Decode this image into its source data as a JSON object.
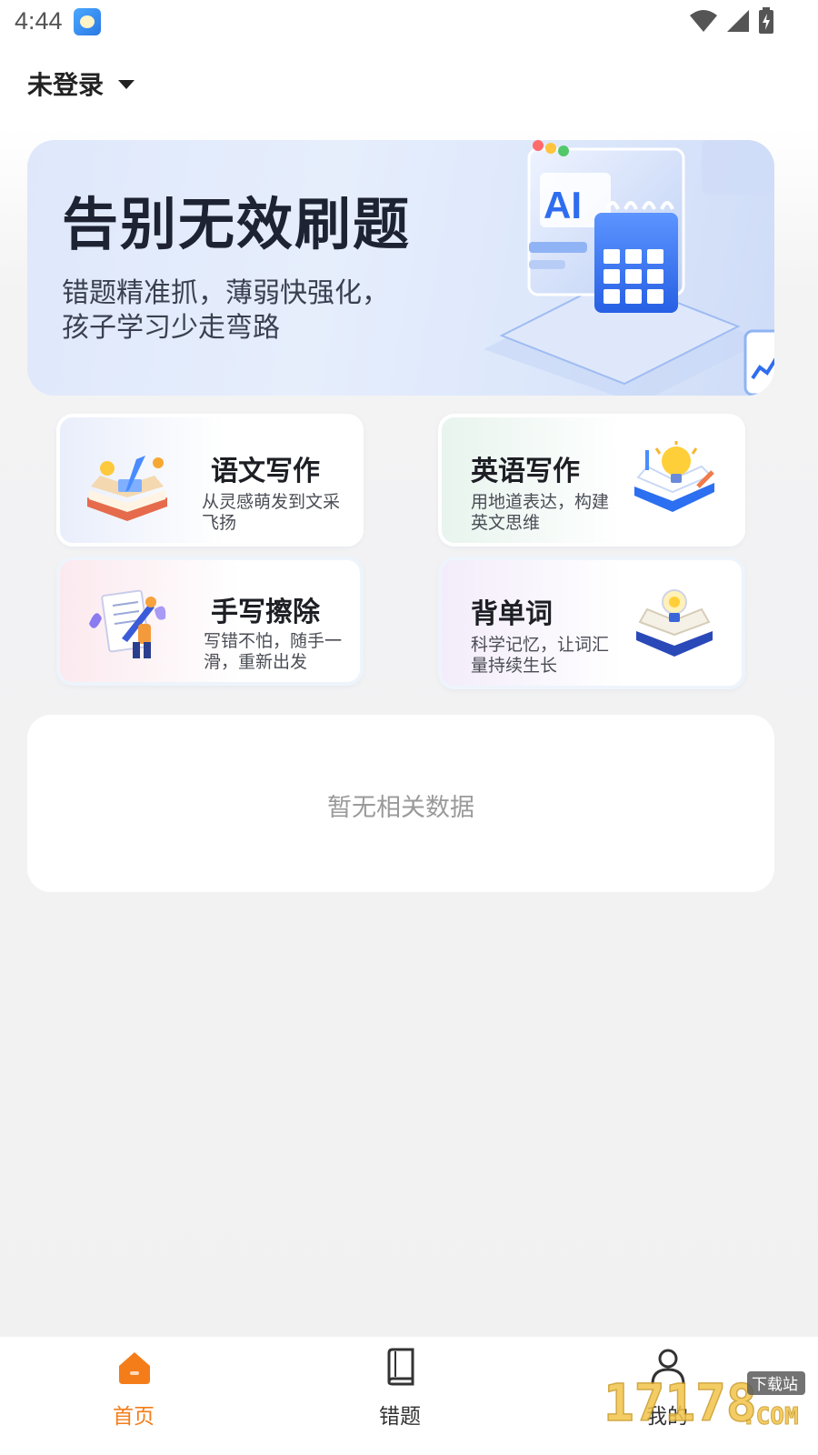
{
  "status_bar": {
    "time": "4:44",
    "icons": [
      "app-notification-icon",
      "wifi-icon",
      "signal-icon",
      "battery-charging-icon"
    ]
  },
  "header": {
    "login_label": "未登录"
  },
  "banner": {
    "title": "告别无效刷题",
    "subtitle_line1": "错题精准抓，薄弱快强化，",
    "subtitle_line2": "孩子学习少走弯路",
    "art_text": "AI"
  },
  "features": [
    {
      "title": "语文写作",
      "description": "从灵感萌发到文采飞扬",
      "icon": "open-book-pen-icon"
    },
    {
      "title": "英语写作",
      "description": "用地道表达，构建英文思维",
      "icon": "lightbulb-book-icon"
    },
    {
      "title": "手写擦除",
      "description": "写错不怕，随手一滑，重新出发",
      "icon": "handwriting-pen-icon"
    },
    {
      "title": "背单词",
      "description": "科学记忆，让词汇量持续生长",
      "icon": "book-lightbulb-icon"
    }
  ],
  "empty_state": {
    "text": "暂无相关数据"
  },
  "bottom_nav": {
    "items": [
      {
        "label": "首页",
        "icon": "home-icon",
        "active": true
      },
      {
        "label": "错题",
        "icon": "book-icon",
        "active": false
      },
      {
        "label": "我的",
        "icon": "person-icon",
        "active": false
      }
    ],
    "active_color": "#f47d1a"
  },
  "watermark": {
    "text": "17178",
    "sub": "下载站",
    "domain": ".COM"
  }
}
